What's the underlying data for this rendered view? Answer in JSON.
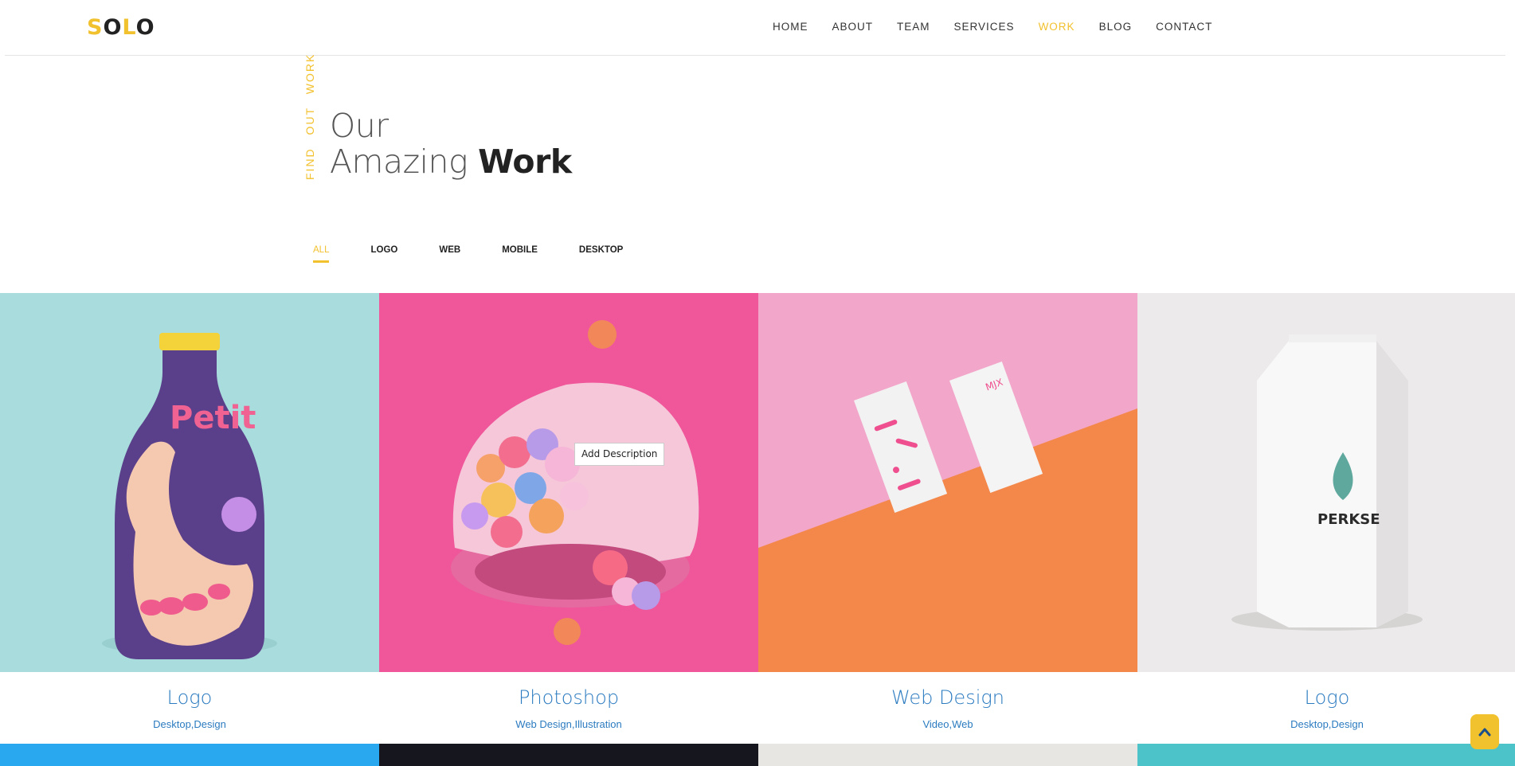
{
  "brand": {
    "letters": [
      "S",
      "O",
      "L",
      "O"
    ]
  },
  "nav": [
    {
      "label": "HOME",
      "active": false
    },
    {
      "label": "ABOUT",
      "active": false
    },
    {
      "label": "TEAM",
      "active": false
    },
    {
      "label": "SERVICES",
      "active": false
    },
    {
      "label": "WORK",
      "active": true
    },
    {
      "label": "BLOG",
      "active": false
    },
    {
      "label": "CONTACT",
      "active": false
    }
  ],
  "section": {
    "vertical_label": "FIND OUT WORK",
    "title_line1": "Our",
    "title_line2_light": "Amazing",
    "title_line2_bold": "Work"
  },
  "filters": [
    "ALL",
    "LOGO",
    "WEB",
    "MOBILE",
    "DESKTOP"
  ],
  "portfolio": [
    {
      "title": "Logo",
      "categories": "Desktop,Design",
      "image": "bottle-image"
    },
    {
      "title": "Photoshop",
      "categories": "Web Design,Illustration",
      "image": "helmet-image"
    },
    {
      "title": "Web Design",
      "categories": "Video,Web",
      "image": "business-cards-image"
    },
    {
      "title": "Logo",
      "categories": "Desktop,Design",
      "image": "milk-carton-image"
    }
  ],
  "tooltip": "Add Description",
  "colors": {
    "accent": "#f2c12e",
    "link": "#2b7bc0",
    "strip1": "#29a8f0",
    "strip2": "#16161e",
    "strip3": "#e8e6e2",
    "strip4": "#4bc3c8"
  },
  "icons": {
    "scroll_top": "chevron-up-icon"
  }
}
